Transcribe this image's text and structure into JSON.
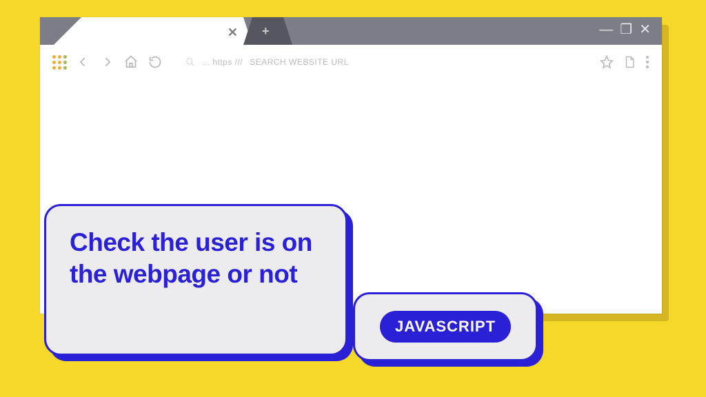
{
  "browser": {
    "tab_close_symbol": "✕",
    "new_tab_symbol": "+",
    "window_controls": {
      "min": "—",
      "max": "❐",
      "close": "✕"
    },
    "toolbar": {
      "url_prefix": "... https ///",
      "url_placeholder": "SEARCH WEBSITE URL"
    }
  },
  "caption": {
    "title": "Check the user is on the webpage or not",
    "tag": "JAVASCRIPT"
  },
  "colors": {
    "page_bg": "#f6d82b",
    "titlebar": "#7b7d87",
    "accent": "#2a21d6",
    "card_bg": "#ececef"
  }
}
